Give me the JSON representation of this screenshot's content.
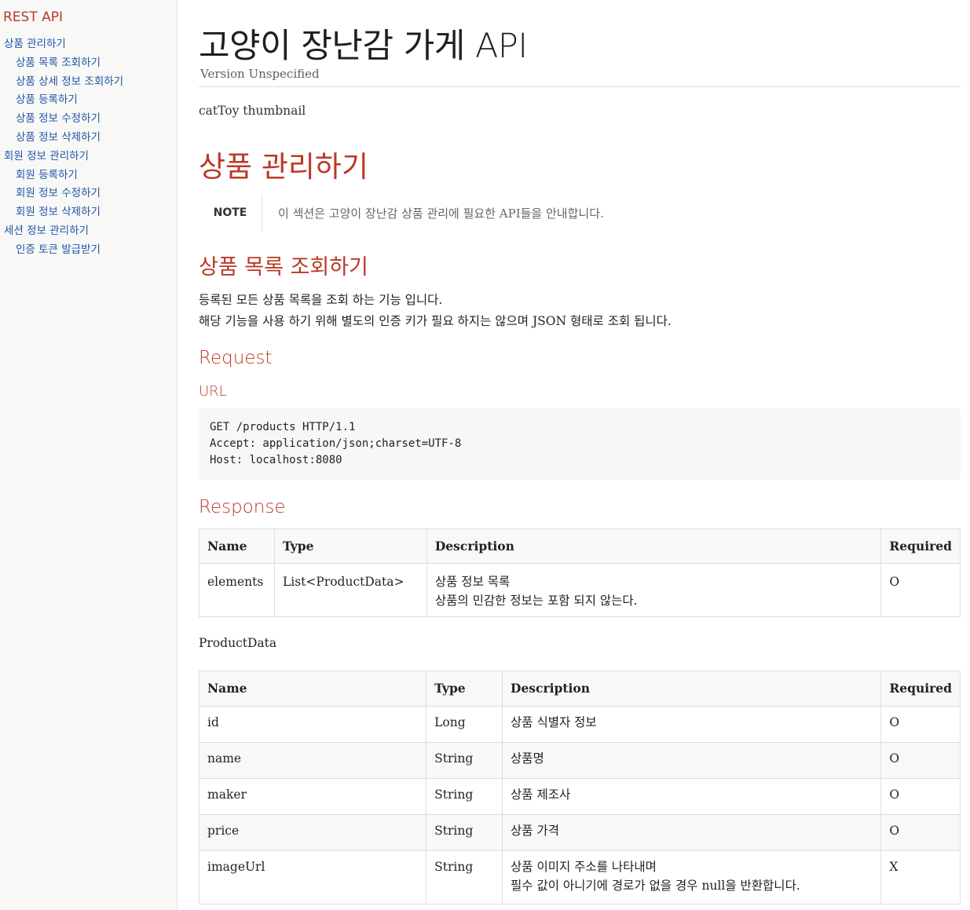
{
  "toc": {
    "title": "REST API",
    "items": [
      {
        "label": "상품 관리하기",
        "level": 1
      },
      {
        "label": "상품 목록 조회하기",
        "level": 2
      },
      {
        "label": "상품 상세 정보 조회하기",
        "level": 2
      },
      {
        "label": "상품 등록하기",
        "level": 2
      },
      {
        "label": "상품 정보 수정하기",
        "level": 2
      },
      {
        "label": "상품 정보 삭제하기",
        "level": 2
      },
      {
        "label": "회원 정보 관리하기",
        "level": 1
      },
      {
        "label": "회원 등록하기",
        "level": 2
      },
      {
        "label": "회원 정보 수정하기",
        "level": 2
      },
      {
        "label": "회원 정보 삭제하기",
        "level": 2
      },
      {
        "label": "세션 정보 관리하기",
        "level": 1
      },
      {
        "label": "인증 토큰 발급받기",
        "level": 2
      }
    ]
  },
  "header": {
    "title": "고양이 장난감 가게 API",
    "version": "Version Unspecified",
    "image_alt": "catToy thumbnail"
  },
  "section": {
    "title": "상품 관리하기",
    "note_label": "NOTE",
    "note_text": "이 섹션은 고양이 장난감 상품 관리에 필요한 API들을 안내합니다."
  },
  "subsection": {
    "title": "상품 목록 조회하기",
    "para1": "등록된 모든 상품 목록을 조회 하는 기능 입니다.",
    "para2": "해당 기능을 사용 하기 위해 별도의 인증 키가 필요 하지는 않으며 JSON 형태로 조회 됩니다.",
    "request_heading": "Request",
    "url_heading": "URL",
    "code": "GET /products HTTP/1.1\nAccept: application/json;charset=UTF-8\nHost: localhost:8080",
    "response_heading": "Response"
  },
  "response_table": {
    "headers": [
      "Name",
      "Type",
      "Description",
      "Required"
    ],
    "rows": [
      {
        "name": "elements",
        "type": "List<ProductData>",
        "desc1": "상품 정보 목록",
        "desc2": "상품의 민감한 정보는 포함 되지 않는다.",
        "required": "O"
      }
    ]
  },
  "product_data": {
    "caption": "ProductData",
    "headers": [
      "Name",
      "Type",
      "Description",
      "Required"
    ],
    "rows": [
      {
        "name": "id",
        "type": "Long",
        "desc1": "상품 식별자 정보",
        "required": "O"
      },
      {
        "name": "name",
        "type": "String",
        "desc1": "상품명",
        "required": "O"
      },
      {
        "name": "maker",
        "type": "String",
        "desc1": "상품 제조사",
        "required": "O"
      },
      {
        "name": "price",
        "type": "String",
        "desc1": "상품 가격",
        "required": "O"
      },
      {
        "name": "imageUrl",
        "type": "String",
        "desc1": "상품 이미지 주소를 나타내며",
        "desc2": "필수 값이 아니기에 경로가 없을 경우 null을 반환합니다.",
        "required": "X"
      }
    ]
  }
}
